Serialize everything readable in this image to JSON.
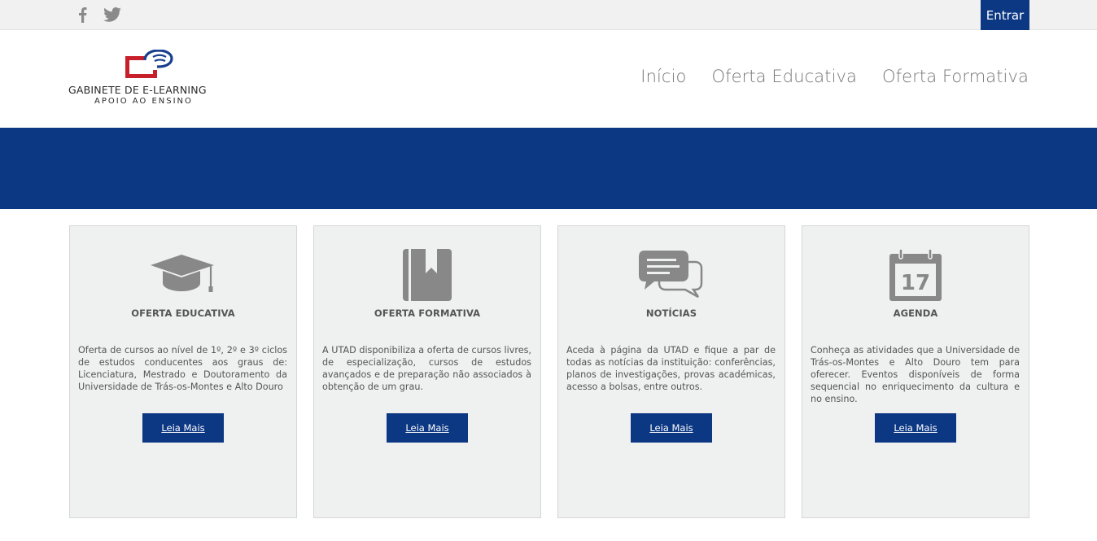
{
  "topbar": {
    "social": [
      {
        "icon": "facebook-icon"
      },
      {
        "icon": "twitter-icon"
      }
    ],
    "login_label": "Entrar"
  },
  "logo": {
    "line1": "GABINETE DE E-LEARNING",
    "line2": "APOIO AO ENSINO"
  },
  "nav": {
    "items": [
      {
        "label": "Início"
      },
      {
        "label": "Oferta Educativa"
      },
      {
        "label": "Oferta Formativa"
      }
    ]
  },
  "colors": {
    "brand_blue": "#0c3783",
    "logo_red": "#c8202b",
    "icon_gray": "#888888"
  },
  "cards": [
    {
      "icon": "graduation-cap-icon",
      "title": "OFERTA EDUCATIVA",
      "description": "Oferta de cursos ao nível de 1º, 2º e 3º ciclos de estudos conducentes aos graus de: Licenciatura, Mestrado e Doutoramento da Universidade de Trás-os-Montes e Alto Douro",
      "button": "Leia Mais"
    },
    {
      "icon": "bookmark-book-icon",
      "title": "OFERTA FORMATIVA",
      "description": "A UTAD disponibiliza a oferta de cursos livres, de especialização, cursos de estudos avançados e de preparação não associados à obtenção de um grau.",
      "button": "Leia Mais"
    },
    {
      "icon": "chat-bubbles-icon",
      "title": "NOTÍCIAS",
      "description": "Aceda à página da UTAD e fique a par de todas as notícias da instituição: conferências, planos de investigações, provas académicas, acesso a bolsas, entre outros.",
      "button": "Leia Mais"
    },
    {
      "icon": "calendar-icon",
      "title": "AGENDA",
      "calendar_day": "17",
      "description": "Conheça as atividades que a Universidade de Trás-os-Montes e Alto Douro tem para oferecer. Eventos disponíveis de forma sequencial no enriquecimento da cultura e no ensino.",
      "button": "Leia Mais"
    }
  ]
}
